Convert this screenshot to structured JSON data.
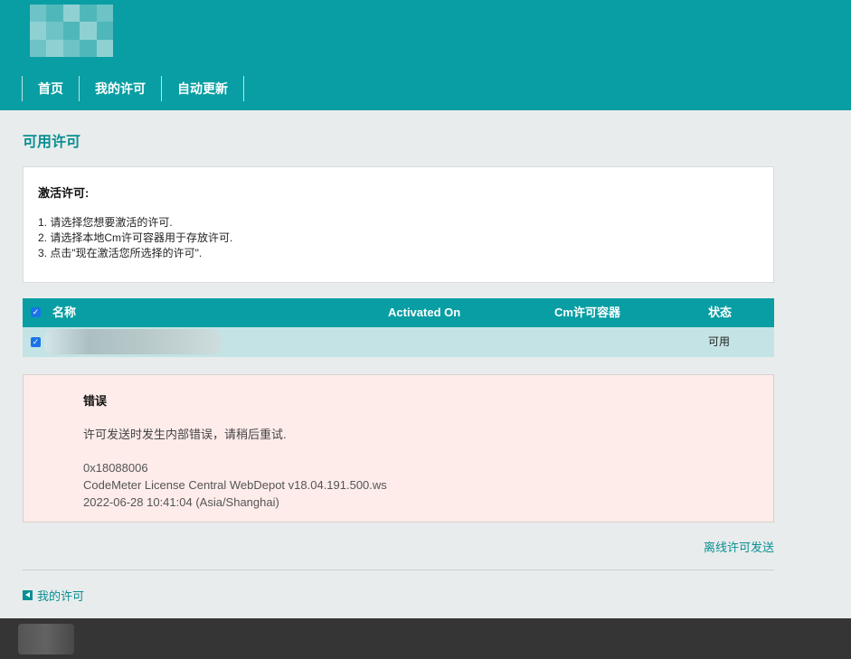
{
  "nav": {
    "items": [
      "首页",
      "我的许可",
      "自动更新"
    ]
  },
  "page": {
    "title": "可用许可"
  },
  "activation": {
    "heading": "激活许可:",
    "steps": [
      "1. 请选择您想要激活的许可.",
      "2. 请选择本地Cm许可容器用于存放许可.",
      "3. 点击\"现在激活您所选择的许可\"."
    ]
  },
  "table": {
    "headers": {
      "name": "名称",
      "activated_on": "Activated On",
      "container": "Cm许可容器",
      "status": "状态"
    },
    "rows": [
      {
        "checked": true,
        "status": "可用"
      }
    ]
  },
  "error": {
    "heading": "错误",
    "message": "许可发送时发生内部错误，请稍后重试.",
    "code": "0x18088006",
    "version": "CodeMeter License Central WebDepot v18.04.191.500.ws",
    "timestamp": "2022-06-28 10:41:04 (Asia/Shanghai)"
  },
  "links": {
    "offline": "离线许可发送",
    "back": "我的许可"
  },
  "colors": {
    "brand": "#089ea3",
    "row_bg": "#c3e3e5",
    "error_bg": "#fdecea",
    "footer": "#353535"
  }
}
